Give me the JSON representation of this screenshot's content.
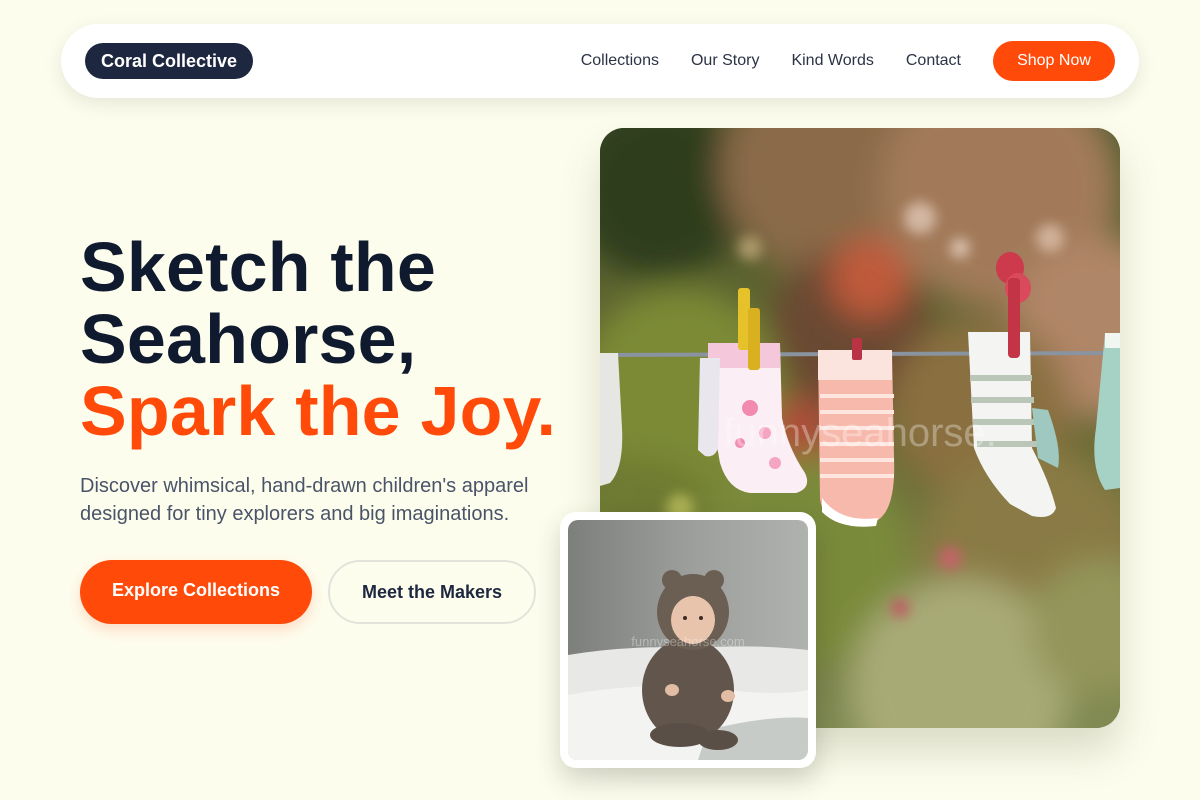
{
  "brand": {
    "name": "Coral Collective"
  },
  "nav": {
    "links": [
      "Collections",
      "Our Story",
      "Kind Words",
      "Contact"
    ],
    "cta": "Shop Now"
  },
  "hero": {
    "title_line1": "Sketch the",
    "title_line2": "Seahorse,",
    "title_line3": "Spark the Joy.",
    "description": "Discover whimsical, hand-drawn children's apparel designed for tiny explorers and big imaginations.",
    "primary_button": "Explore Collections",
    "secondary_button": "Meet the Makers"
  },
  "images": {
    "main_watermark": "funnyseahorse.",
    "sub_watermark": "funnyseahorse.com"
  },
  "colors": {
    "accent": "#ff4a0a",
    "navy": "#1d2840",
    "background": "#fdfdee"
  }
}
